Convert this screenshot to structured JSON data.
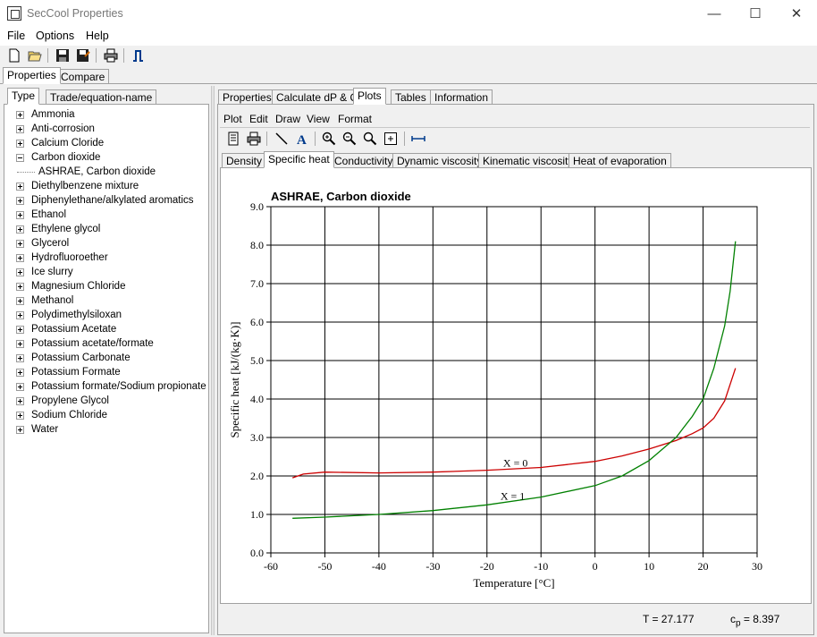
{
  "window": {
    "title": "SecCool Properties",
    "controls": {
      "minimize": "—",
      "maximize": "☐",
      "close": "✕"
    }
  },
  "menubar": {
    "items": [
      "File",
      "Options",
      "Help"
    ]
  },
  "main_tabs": [
    "Properties",
    "Compare"
  ],
  "left_tabs": [
    "Type",
    "Trade/equation-name"
  ],
  "tree": {
    "items": [
      {
        "label": "Ammonia",
        "expanded": false
      },
      {
        "label": "Anti-corrosion",
        "expanded": false
      },
      {
        "label": "Calcium Cloride",
        "expanded": false
      },
      {
        "label": "Carbon dioxide",
        "expanded": true
      },
      {
        "label": "ASHRAE, Carbon dioxide",
        "child": true
      },
      {
        "label": "Diethylbenzene mixture",
        "expanded": false
      },
      {
        "label": "Diphenylethane/alkylated aromatics",
        "expanded": false
      },
      {
        "label": "Ethanol",
        "expanded": false
      },
      {
        "label": "Ethylene glycol",
        "expanded": false
      },
      {
        "label": "Glycerol",
        "expanded": false
      },
      {
        "label": "Hydrofluoroether",
        "expanded": false
      },
      {
        "label": "Ice slurry",
        "expanded": false
      },
      {
        "label": "Magnesium Chloride",
        "expanded": false
      },
      {
        "label": "Methanol",
        "expanded": false
      },
      {
        "label": "Polydimethylsiloxan",
        "expanded": false
      },
      {
        "label": "Potassium Acetate",
        "expanded": false
      },
      {
        "label": "Potassium acetate/formate",
        "expanded": false
      },
      {
        "label": "Potassium Carbonate",
        "expanded": false
      },
      {
        "label": "Potassium Formate",
        "expanded": false
      },
      {
        "label": "Potassium formate/Sodium propionate",
        "expanded": false
      },
      {
        "label": "Propylene Glycol",
        "expanded": false
      },
      {
        "label": "Sodium Chloride",
        "expanded": false
      },
      {
        "label": "Water",
        "expanded": false
      }
    ]
  },
  "right_tabs": [
    "Properties",
    "Calculate dP & Q",
    "Plots",
    "Tables",
    "Information"
  ],
  "plot_menu": [
    "Plot",
    "Edit",
    "Draw",
    "View",
    "Format"
  ],
  "plot_tabs": [
    "Density",
    "Specific heat",
    "Conductivity",
    "Dynamic viscosity",
    "Kinematic viscosity",
    "Heat of evaporation"
  ],
  "status": {
    "t_text": "T = 27.177",
    "cp_prefix": "c",
    "cp_sub": "p",
    "cp_value": " = 8.397"
  },
  "colors": {
    "x0": "#cc0000",
    "x1": "#008000",
    "grid": "#000000"
  },
  "chart_data": {
    "type": "line",
    "title": "ASHRAE, Carbon dioxide",
    "xlabel": "Temperature [°C]",
    "ylabel": "Specific heat [kJ/(kg·K)]",
    "xlim": [
      -60,
      30
    ],
    "ylim": [
      0,
      9
    ],
    "xticks": [
      "-60",
      "-50",
      "-40",
      "-30",
      "-20",
      "-10",
      "0",
      "10",
      "20",
      "30"
    ],
    "yticks": [
      "0.0",
      "1.0",
      "2.0",
      "3.0",
      "4.0",
      "5.0",
      "6.0",
      "7.0",
      "8.0",
      "9.0"
    ],
    "grid": true,
    "series": [
      {
        "name": "X = 0",
        "x": [
          -56,
          -54,
          -50,
          -40,
          -30,
          -20,
          -10,
          0,
          5,
          10,
          15,
          18,
          20,
          22,
          24,
          26
        ],
        "y": [
          1.95,
          2.05,
          2.1,
          2.08,
          2.1,
          2.15,
          2.22,
          2.38,
          2.52,
          2.7,
          2.92,
          3.1,
          3.25,
          3.5,
          3.95,
          4.8
        ]
      },
      {
        "name": "X = 1",
        "x": [
          -56,
          -50,
          -40,
          -30,
          -20,
          -10,
          0,
          5,
          10,
          15,
          18,
          20,
          22,
          24,
          25,
          26
        ],
        "y": [
          0.9,
          0.93,
          1.0,
          1.1,
          1.25,
          1.45,
          1.75,
          2.0,
          2.4,
          3.0,
          3.55,
          4.0,
          4.8,
          5.9,
          6.8,
          8.1
        ]
      }
    ],
    "annotations": [
      "X = 0",
      "X = 1"
    ]
  }
}
